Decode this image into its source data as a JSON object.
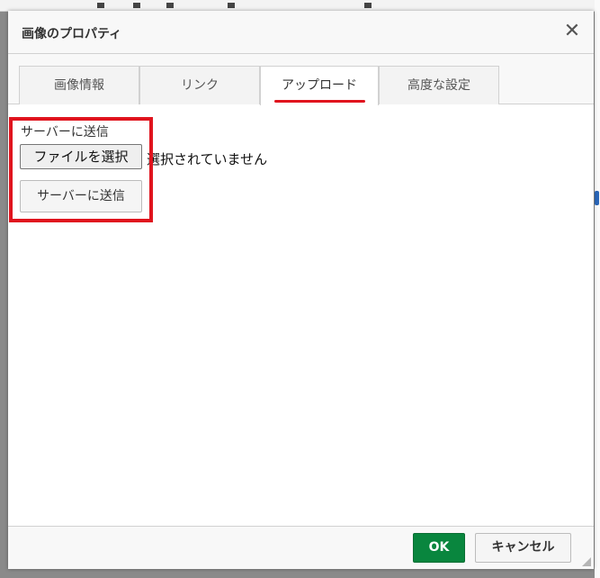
{
  "dialog": {
    "title": "画像のプロパティ",
    "close_glyph": "✕"
  },
  "tabs": [
    {
      "label": "画像情報",
      "active": false
    },
    {
      "label": "リンク",
      "active": false
    },
    {
      "label": "アップロード",
      "active": true
    },
    {
      "label": "高度な設定",
      "active": false
    }
  ],
  "upload": {
    "field_label": "サーバーに送信",
    "file_button_label": "ファイルを選択",
    "file_status": "選択されていません",
    "send_button_label": "サーバーに送信"
  },
  "footer": {
    "ok_label": "OK",
    "cancel_label": "キャンセル"
  },
  "colors": {
    "highlight": "#e0141e",
    "ok_button": "#09863e"
  }
}
